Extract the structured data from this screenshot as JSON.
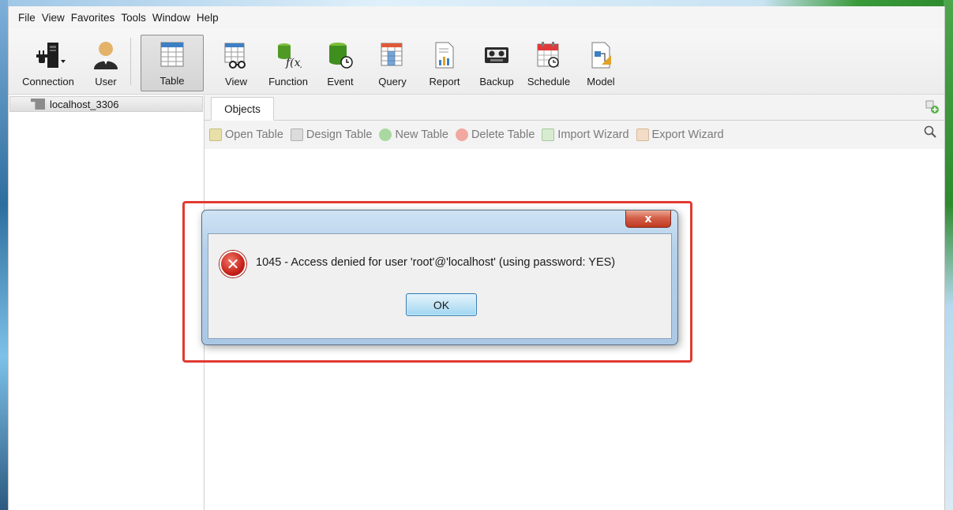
{
  "menu": [
    "File",
    "View",
    "Favorites",
    "Tools",
    "Window",
    "Help"
  ],
  "toolbar": {
    "connection": "Connection",
    "user": "User",
    "items": [
      {
        "label": "Table",
        "icon": "table-icon",
        "active": true
      },
      {
        "label": "View",
        "icon": "view-icon"
      },
      {
        "label": "Function",
        "icon": "function-icon"
      },
      {
        "label": "Event",
        "icon": "event-icon"
      },
      {
        "label": "Query",
        "icon": "query-icon"
      },
      {
        "label": "Report",
        "icon": "report-icon"
      },
      {
        "label": "Backup",
        "icon": "backup-icon"
      },
      {
        "label": "Schedule",
        "icon": "schedule-icon"
      },
      {
        "label": "Model",
        "icon": "model-icon"
      }
    ]
  },
  "sidebar": {
    "connection_name": "localhost_3306"
  },
  "tabs": {
    "objects": "Objects"
  },
  "actions": {
    "open_table": "Open Table",
    "design_table": "Design Table",
    "new_table": "New Table",
    "delete_table": "Delete Table",
    "import_wizard": "Import Wizard",
    "export_wizard": "Export Wizard"
  },
  "dialog": {
    "close_label": "x",
    "message": "1045 - Access denied for user 'root'@'localhost' (using password: YES)",
    "ok_label": "OK"
  },
  "colors": {
    "highlight": "#e23a32",
    "error": "#c8231a",
    "accent_green": "#2f9a3a"
  }
}
